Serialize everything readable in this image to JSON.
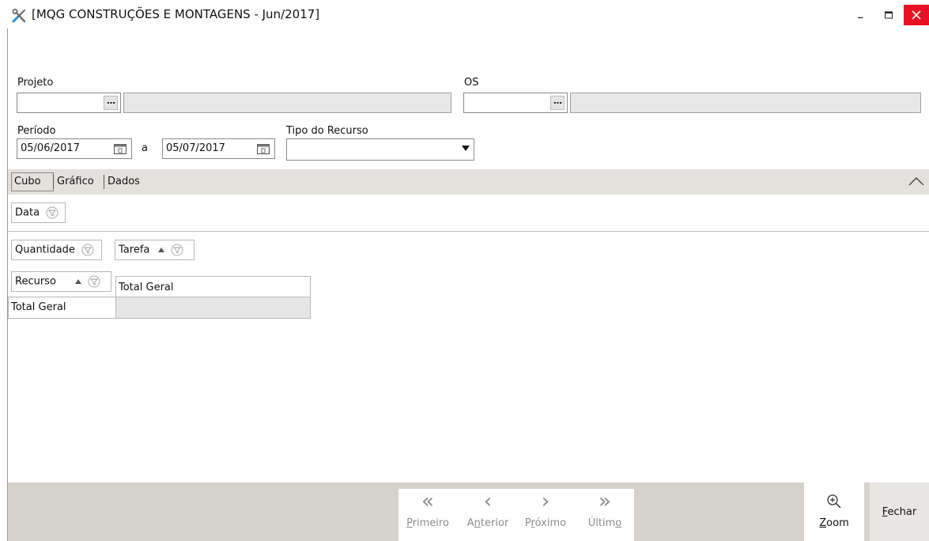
{
  "window": {
    "title": "[MQG CONSTRUÇÕES E MONTAGENS - Jun/2017]",
    "min_glyph": "_",
    "icon": "tools-icon"
  },
  "filters": {
    "projeto_label": "Projeto",
    "projeto_code": "",
    "projeto_desc": "",
    "os_label": "OS",
    "os_code": "",
    "os_desc": "",
    "periodo_label": "Período",
    "date_from": "05/06/2017",
    "date_sep": "a",
    "date_to": "05/07/2017",
    "tipo_recurso_label": "Tipo do Recurso",
    "tipo_recurso_value": "",
    "lookup_glyph": "…"
  },
  "tabs": [
    {
      "label": "Cubo",
      "active": true
    },
    {
      "label": "Gráfico",
      "active": false
    },
    {
      "label": "Dados",
      "active": false
    }
  ],
  "cube": {
    "filter_field": "Data",
    "data_field": "Quantidade",
    "column_field": "Tarefa",
    "row_field": "Recurso",
    "column_header": "Total Geral",
    "row_header": "Total Geral",
    "total_value": ""
  },
  "nav": {
    "first": {
      "pre": "",
      "key": "P",
      "post": "rimeiro",
      "glyph": "«"
    },
    "prev": {
      "pre": "A",
      "key": "n",
      "post": "terior",
      "glyph": "‹"
    },
    "next": {
      "pre": "P",
      "key": "r",
      "post": "óximo",
      "glyph": "›"
    },
    "last": {
      "pre": "Últim",
      "key": "o",
      "post": "",
      "glyph": "»"
    }
  },
  "actions": {
    "zoom": {
      "pre": "",
      "key": "Z",
      "post": "oom"
    },
    "close": {
      "pre": "",
      "key": "F",
      "post": "echar"
    }
  },
  "colors": {
    "close_button": "#e81123",
    "toolbar_bg": "#d6d2cc",
    "tabbar_bg": "#e4e1dc",
    "disabled_text": "#8c8c8c"
  }
}
